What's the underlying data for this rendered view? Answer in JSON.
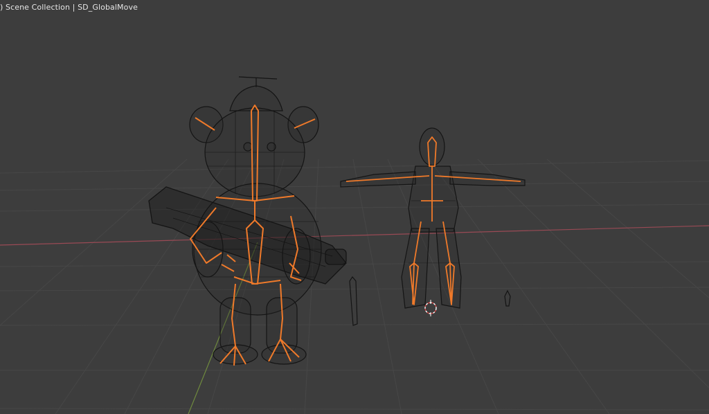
{
  "viewport": {
    "info_prefix": ")",
    "collection": "Scene Collection",
    "separator": "|",
    "object": "SD_GlobalMove"
  },
  "colors": {
    "background": "#3d3d3d",
    "grid": "#474747",
    "x_axis": "#9a4a55",
    "y_axis": "#6f8a3e",
    "wire": "#141414",
    "bone": "#f07a2a",
    "cursor": "#ffffff"
  },
  "objects": [
    {
      "name": "bear-character",
      "type": "mesh+armature"
    },
    {
      "name": "humanoid-character",
      "type": "mesh+armature"
    },
    {
      "name": "small-bone-left",
      "type": "bone"
    },
    {
      "name": "small-bone-right",
      "type": "bone"
    }
  ]
}
